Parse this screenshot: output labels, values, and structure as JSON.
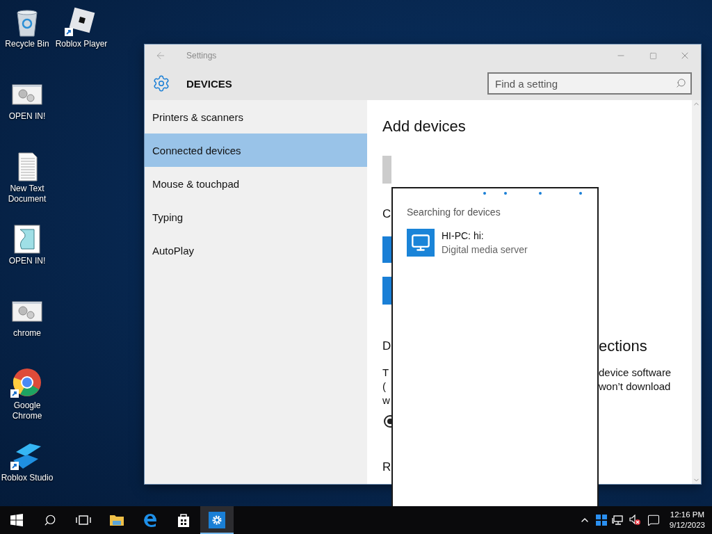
{
  "desktop_icons": [
    {
      "label": "Recycle Bin",
      "kind": "recycle",
      "shortcut": false
    },
    {
      "label": "Roblox Player",
      "kind": "roblox",
      "shortcut": true
    },
    {
      "label": "OPEN IN!",
      "kind": "gears",
      "shortcut": false
    },
    {
      "label": "New Text Document",
      "kind": "text",
      "shortcut": false
    },
    {
      "label": "OPEN IN!",
      "kind": "script",
      "shortcut": false
    },
    {
      "label": "chrome",
      "kind": "gears",
      "shortcut": false
    },
    {
      "label": "Google Chrome",
      "kind": "chrome",
      "shortcut": true
    },
    {
      "label": "Roblox Studio",
      "kind": "studio",
      "shortcut": true
    }
  ],
  "window": {
    "title": "Settings",
    "section": "DEVICES",
    "search": {
      "placeholder": "Find a setting"
    }
  },
  "sidebar": {
    "items": [
      {
        "label": "Printers & scanners",
        "selected": false
      },
      {
        "label": "Connected devices",
        "selected": true
      },
      {
        "label": "Mouse & touchpad",
        "selected": false
      },
      {
        "label": "Typing",
        "selected": false
      },
      {
        "label": "AutoPlay",
        "selected": false
      }
    ]
  },
  "content": {
    "heading": "Add devices",
    "section_2_heading": "C",
    "section_3_heading_left": "D",
    "section_3_heading_right": "ections",
    "paragraph_lines": [
      {
        "left": "T",
        "right": "device software"
      },
      {
        "left": "(",
        "right": "won’t download"
      },
      {
        "left": "w"
      }
    ],
    "radio_selected": true,
    "section_4_heading": "R"
  },
  "dialog": {
    "heading": "Searching for devices",
    "devices": [
      {
        "name": "HI-PC: hi:",
        "type": "Digital media server"
      }
    ]
  },
  "taskbar": {
    "apps": [
      {
        "kind": "explorer",
        "selected": false
      },
      {
        "kind": "edge",
        "selected": false
      },
      {
        "kind": "store",
        "selected": false
      },
      {
        "kind": "settings",
        "selected": true
      }
    ],
    "time": "12:16 PM",
    "date": "9/12/2023"
  }
}
